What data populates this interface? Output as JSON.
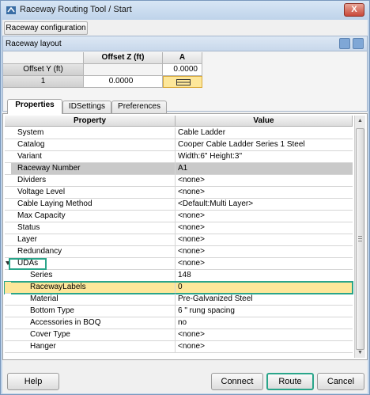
{
  "window": {
    "title": "Raceway Routing Tool / Start",
    "close_label": "X"
  },
  "config_button": "Raceway configuration",
  "layout": {
    "title": "Raceway layout",
    "col_offset_header": "Offset Z (ft)",
    "col_a_header": "A",
    "row_offset_label": "Offset Y (ft)",
    "row_offset_value": "0.0000",
    "row1_label": "1",
    "row1_value": "0.0000"
  },
  "tabs": [
    {
      "label": "Properties",
      "active": true
    },
    {
      "label": "IDSettings",
      "active": false
    },
    {
      "label": "Preferences",
      "active": false
    }
  ],
  "properties": {
    "header_property": "Property",
    "header_value": "Value",
    "rows": [
      {
        "name": "System",
        "value": "Cable Ladder"
      },
      {
        "name": "Catalog",
        "value": "Cooper Cable Ladder Series 1 Steel"
      },
      {
        "name": "Variant",
        "value": "Width:6\" Height:3\""
      },
      {
        "name": "Raceway Number",
        "value": "A1"
      },
      {
        "name": "Dividers",
        "value": "<none>"
      },
      {
        "name": "Voltage Level",
        "value": "<none>"
      },
      {
        "name": "Cable Laying Method",
        "value": "<Default:Multi Layer>"
      },
      {
        "name": "Max Capacity",
        "value": "<none>"
      },
      {
        "name": "Status",
        "value": "<none>"
      },
      {
        "name": "Layer",
        "value": "<none>"
      },
      {
        "name": "Redundancy",
        "value": "<none>"
      },
      {
        "name": "UDAs",
        "value": "<none>"
      },
      {
        "name": "Series",
        "value": "148"
      },
      {
        "name": "RacewayLabels",
        "value": "0"
      },
      {
        "name": "Material",
        "value": "Pre-Galvanized Steel"
      },
      {
        "name": "Bottom Type",
        "value": "6 \" rung spacing"
      },
      {
        "name": "Accessories in BOQ",
        "value": "no"
      },
      {
        "name": "Cover Type",
        "value": "<none>"
      },
      {
        "name": "Hanger",
        "value": "<none>"
      }
    ]
  },
  "buttons": {
    "help": "Help",
    "connect": "Connect",
    "route": "Route",
    "cancel": "Cancel"
  },
  "colors": {
    "highlight": "#fde79a",
    "annotation": "#2aa58a",
    "selected_row": "#c9c9c9"
  }
}
